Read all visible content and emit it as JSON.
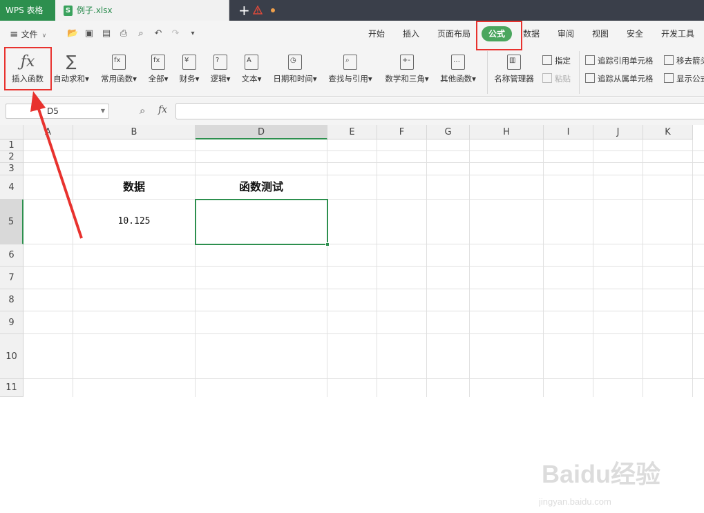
{
  "titlebar": {
    "app_name": "WPS 表格",
    "file_name": "例子.xlsx",
    "file_icon_letter": "S",
    "new_tab": "+"
  },
  "menubar": {
    "file_menu": "文件",
    "tabs": [
      "开始",
      "插入",
      "页面布局",
      "公式",
      "数据",
      "审阅",
      "视图",
      "安全",
      "开发工具"
    ],
    "active_tab": "公式"
  },
  "ribbon": {
    "insert_function": "插入函数",
    "autosum": "自动求和",
    "common_functions": "常用函数",
    "all": "全部",
    "finance": "财务",
    "logic": "逻辑",
    "text": "文本",
    "datetime": "日期和时间",
    "lookup": "查找与引用",
    "math_trig": "数学和三角",
    "other_functions": "其他函数",
    "name_manager": "名称管理器",
    "specify": "指定",
    "paste": "粘贴",
    "trace_precedents": "追踪引用单元格",
    "trace_dependents": "追踪从属单元格",
    "remove_arrows": "移去箭头",
    "show_formulas": "显示公式"
  },
  "formula_bar": {
    "name_box": "D5",
    "fx": "fx",
    "formula": ""
  },
  "sheet": {
    "columns": [
      "A",
      "B",
      "D",
      "E",
      "F",
      "G",
      "H",
      "I",
      "J",
      "K"
    ],
    "rows": [
      "1",
      "2",
      "3",
      "4",
      "5",
      "6",
      "7",
      "8",
      "9",
      "10",
      "11"
    ],
    "selected_col": "D",
    "selected_row": "5",
    "cells": {
      "B4": "数据",
      "D4": "函数测试",
      "B5": "10.125",
      "D5": ""
    }
  },
  "watermark": {
    "brand": "Baidu经验",
    "url": "jingyan.baidu.com"
  },
  "colors": {
    "accent": "#2d8f4e",
    "highlight": "#e8322e",
    "active_tab": "#4aa65e"
  }
}
